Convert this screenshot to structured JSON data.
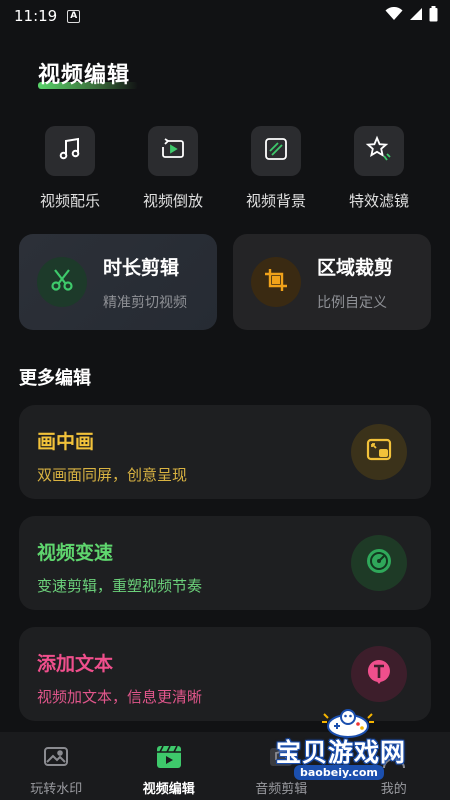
{
  "status_bar": {
    "time": "11:19",
    "notification_letter": "A"
  },
  "page": {
    "title": "视频编辑"
  },
  "tools": [
    {
      "label": "视频配乐",
      "icon": "music-note-icon"
    },
    {
      "label": "视频倒放",
      "icon": "reverse-play-icon"
    },
    {
      "label": "视频背景",
      "icon": "background-icon"
    },
    {
      "label": "特效滤镜",
      "icon": "star-filter-icon"
    }
  ],
  "big_cards": [
    {
      "title": "时长剪辑",
      "subtitle": "精准剪切视频",
      "icon": "scissors-icon",
      "accent": "#37c76a"
    },
    {
      "title": "区域裁剪",
      "subtitle": "比例自定义",
      "icon": "crop-icon",
      "accent": "#f0a21a"
    }
  ],
  "more": {
    "title": "更多编辑",
    "items": [
      {
        "title": "画中画",
        "subtitle": "双画面同屏，创意呈现",
        "color": "#f2c23a",
        "icon": "picture-in-picture-icon"
      },
      {
        "title": "视频变速",
        "subtitle": "变速剪辑，重塑视频节奏",
        "color": "#5fd66e",
        "icon": "speedometer-icon"
      },
      {
        "title": "添加文本",
        "subtitle": "视频加文本，信息更清晰",
        "color": "#ef4f8c",
        "icon": "text-t-icon"
      }
    ]
  },
  "tabs": [
    {
      "label": "玩转水印",
      "icon": "watermark-image-icon",
      "active": false
    },
    {
      "label": "视频编辑",
      "icon": "clapperboard-icon",
      "active": true
    },
    {
      "label": "音频剪辑",
      "icon": "audio-icon",
      "active": false
    },
    {
      "label": "我的",
      "icon": "profile-icon",
      "active": false
    }
  ],
  "watermark": {
    "text": "宝贝游戏网",
    "url": "baobeiy.com"
  }
}
